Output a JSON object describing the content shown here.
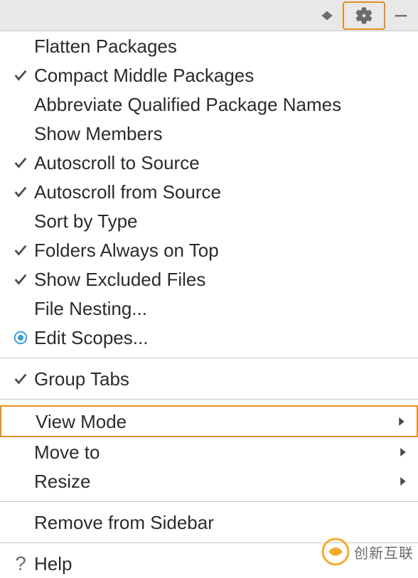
{
  "toolbar": {
    "hide_icon": "hide",
    "gear_icon": "gear",
    "minimize_icon": "minimize"
  },
  "menu": {
    "section1": [
      {
        "label": "Flatten Packages",
        "icon": "none"
      },
      {
        "label": "Compact Middle Packages",
        "icon": "check"
      },
      {
        "label": "Abbreviate Qualified Package Names",
        "icon": "none"
      },
      {
        "label": "Show Members",
        "icon": "none"
      },
      {
        "label": "Autoscroll to Source",
        "icon": "check"
      },
      {
        "label": "Autoscroll from Source",
        "icon": "check"
      },
      {
        "label": "Sort by Type",
        "icon": "none"
      },
      {
        "label": "Folders Always on Top",
        "icon": "check"
      },
      {
        "label": "Show Excluded Files",
        "icon": "check"
      },
      {
        "label": "File Nesting...",
        "icon": "none"
      },
      {
        "label": "Edit Scopes...",
        "icon": "radio"
      }
    ],
    "section2": [
      {
        "label": "Group Tabs",
        "icon": "check"
      }
    ],
    "section3": [
      {
        "label": "View Mode",
        "icon": "none",
        "submenu": true,
        "highlight": true
      },
      {
        "label": "Move to",
        "icon": "none",
        "submenu": true
      },
      {
        "label": "Resize",
        "icon": "none",
        "submenu": true
      }
    ],
    "section4": [
      {
        "label": "Remove from Sidebar",
        "icon": "none"
      }
    ],
    "section5": [
      {
        "label": "Help",
        "icon": "question"
      }
    ]
  },
  "watermark": {
    "text": "创新互联"
  }
}
